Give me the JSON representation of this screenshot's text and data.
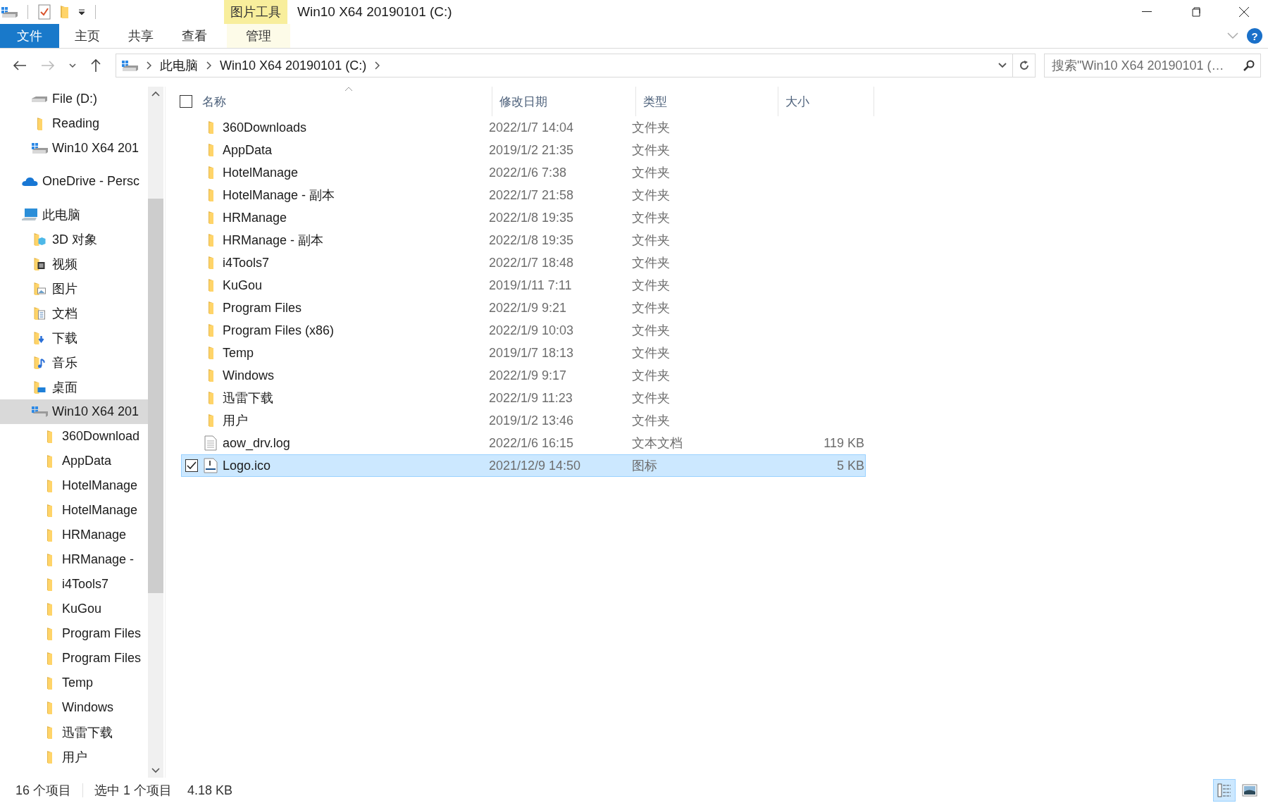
{
  "window": {
    "title": "Win10 X64 20190101 (C:)",
    "contextual_tab_group": "图片工具",
    "help_button": "?"
  },
  "ribbon_tabs": [
    {
      "label": "文件",
      "kind": "file",
      "selected": false
    },
    {
      "label": "主页",
      "kind": "normal",
      "selected": false
    },
    {
      "label": "共享",
      "kind": "normal",
      "selected": false
    },
    {
      "label": "查看",
      "kind": "normal",
      "selected": false
    },
    {
      "label": "管理",
      "kind": "contextual",
      "selected": false
    }
  ],
  "address_bar": {
    "breadcrumbs": [
      "此电脑",
      "Win10 X64 20190101 (C:)"
    ]
  },
  "search": {
    "placeholder": "搜索\"Win10 X64 20190101 (…"
  },
  "sidebar": {
    "quick_access": [
      {
        "label": "File (D:)",
        "kind": "drive",
        "selected": false
      },
      {
        "label": "Reading",
        "kind": "folder",
        "selected": false
      },
      {
        "label": "Win10 X64 201",
        "kind": "system-drive",
        "selected": false
      }
    ],
    "items": [
      {
        "label": "OneDrive - Persc",
        "kind": "cloud",
        "selected": false
      },
      {
        "label": "此电脑",
        "kind": "pc",
        "selected": false,
        "children": [
          {
            "label": "3D 对象",
            "kind": "objects",
            "selected": false
          },
          {
            "label": "视频",
            "kind": "video",
            "selected": false
          },
          {
            "label": "图片",
            "kind": "pictures",
            "selected": false
          },
          {
            "label": "文档",
            "kind": "documents",
            "selected": false
          },
          {
            "label": "下载",
            "kind": "downloads",
            "selected": false
          },
          {
            "label": "音乐",
            "kind": "music",
            "selected": false
          },
          {
            "label": "桌面",
            "kind": "desktop",
            "selected": false
          },
          {
            "label": "Win10 X64 201",
            "kind": "system-drive",
            "selected": true,
            "children": [
              {
                "label": "360Download",
                "kind": "folder",
                "selected": false
              },
              {
                "label": "AppData",
                "kind": "folder",
                "selected": false
              },
              {
                "label": "HotelManage",
                "kind": "folder",
                "selected": false
              },
              {
                "label": "HotelManage",
                "kind": "folder",
                "selected": false
              },
              {
                "label": "HRManage",
                "kind": "folder",
                "selected": false
              },
              {
                "label": "HRManage -",
                "kind": "folder",
                "selected": false
              },
              {
                "label": "i4Tools7",
                "kind": "folder",
                "selected": false
              },
              {
                "label": "KuGou",
                "kind": "folder",
                "selected": false
              },
              {
                "label": "Program Files",
                "kind": "folder",
                "selected": false
              },
              {
                "label": "Program Files",
                "kind": "folder",
                "selected": false
              },
              {
                "label": "Temp",
                "kind": "folder",
                "selected": false
              },
              {
                "label": "Windows",
                "kind": "folder",
                "selected": false
              },
              {
                "label": "迅雷下载",
                "kind": "folder",
                "selected": false
              },
              {
                "label": "用户",
                "kind": "folder",
                "selected": false
              }
            ]
          }
        ]
      }
    ]
  },
  "list": {
    "select_all_checked": false,
    "columns": [
      {
        "label": "名称",
        "sorted": true
      },
      {
        "label": "修改日期",
        "sorted": false
      },
      {
        "label": "类型",
        "sorted": false
      },
      {
        "label": "大小",
        "sorted": false
      }
    ],
    "rows": [
      {
        "name": "360Downloads",
        "date": "2022/1/7 14:04",
        "type": "文件夹",
        "kind": "folder",
        "selected": false
      },
      {
        "name": "AppData",
        "date": "2019/1/2 21:35",
        "type": "文件夹",
        "kind": "folder",
        "selected": false
      },
      {
        "name": "HotelManage",
        "date": "2022/1/6 7:38",
        "type": "文件夹",
        "kind": "folder",
        "selected": false
      },
      {
        "name": "HotelManage - 副本",
        "date": "2022/1/7 21:58",
        "type": "文件夹",
        "kind": "folder",
        "selected": false
      },
      {
        "name": "HRManage",
        "date": "2022/1/8 19:35",
        "type": "文件夹",
        "kind": "folder",
        "selected": false
      },
      {
        "name": "HRManage - 副本",
        "date": "2022/1/8 19:35",
        "type": "文件夹",
        "kind": "folder",
        "selected": false
      },
      {
        "name": "i4Tools7",
        "date": "2022/1/7 18:48",
        "type": "文件夹",
        "kind": "folder",
        "selected": false
      },
      {
        "name": "KuGou",
        "date": "2019/1/11 7:11",
        "type": "文件夹",
        "kind": "folder",
        "selected": false
      },
      {
        "name": "Program Files",
        "date": "2022/1/9 9:21",
        "type": "文件夹",
        "kind": "folder",
        "selected": false
      },
      {
        "name": "Program Files (x86)",
        "date": "2022/1/9 10:03",
        "type": "文件夹",
        "kind": "folder",
        "selected": false
      },
      {
        "name": "Temp",
        "date": "2019/1/7 18:13",
        "type": "文件夹",
        "kind": "folder",
        "selected": false
      },
      {
        "name": "Windows",
        "date": "2022/1/9 9:17",
        "type": "文件夹",
        "kind": "folder",
        "selected": false
      },
      {
        "name": "迅雷下载",
        "date": "2022/1/9 11:23",
        "type": "文件夹",
        "kind": "folder",
        "selected": false
      },
      {
        "name": "用户",
        "date": "2019/1/2 13:46",
        "type": "文件夹",
        "kind": "folder",
        "selected": false
      },
      {
        "name": "aow_drv.log",
        "date": "2022/1/6 16:15",
        "type": "文本文档",
        "size": "119 KB",
        "kind": "text",
        "selected": false
      },
      {
        "name": "Logo.ico",
        "date": "2021/12/9 14:50",
        "type": "图标",
        "size": "5 KB",
        "kind": "image",
        "selected": true
      }
    ]
  },
  "status_bar": {
    "item_count": "16 个项目",
    "selection": "选中 1 个项目",
    "selection_size": "4.18 KB"
  },
  "view_buttons": [
    {
      "kind": "details",
      "selected": true
    },
    {
      "kind": "large-icons",
      "selected": false
    }
  ]
}
